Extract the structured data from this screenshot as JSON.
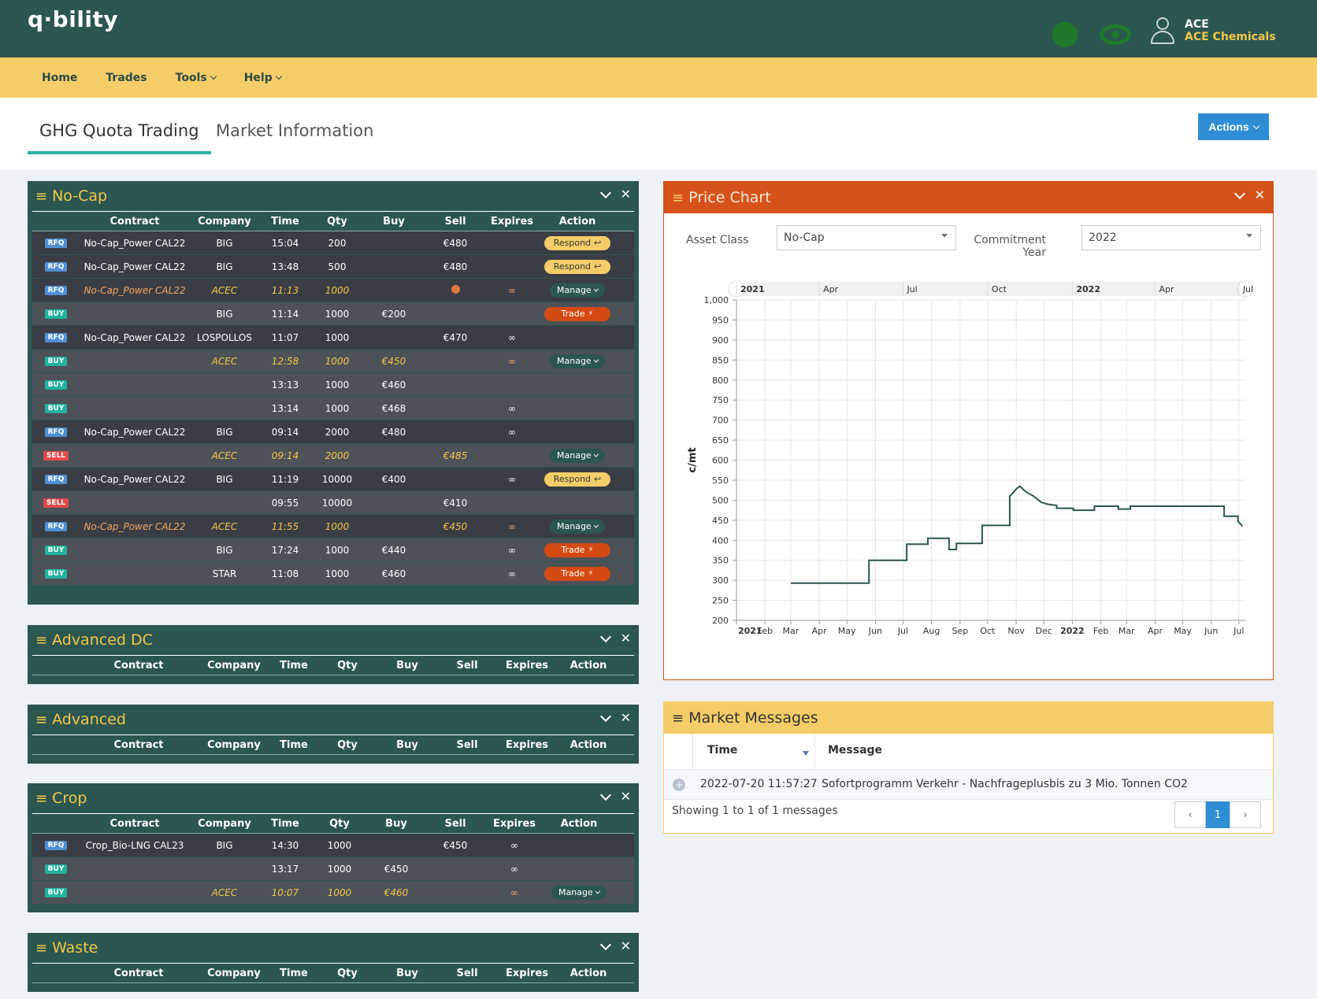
{
  "app": {
    "logo": "q·bility",
    "user_code": "ACE",
    "user_company": "ACE Chemicals"
  },
  "nav": {
    "home": "Home",
    "trades": "Trades",
    "tools": "Tools",
    "help": "Help"
  },
  "tabs": {
    "ghg": "GHG Quota Trading",
    "market": "Market Information"
  },
  "actions_label": "Actions",
  "columns": {
    "contract": "Contract",
    "company": "Company",
    "time": "Time",
    "qty": "Qty",
    "buy": "Buy",
    "sell": "Sell",
    "expires": "Expires",
    "action": "Action"
  },
  "panels": {
    "nocap": "No-Cap",
    "advdc": "Advanced DC",
    "adv": "Advanced",
    "crop": "Crop",
    "waste": "Waste"
  },
  "nocap_rows": [
    {
      "badge": "RFQ",
      "contract": "No-Cap_Power CAL22",
      "company": "BIG",
      "time": "15:04",
      "qty": "200",
      "buy": "",
      "sell": "€480",
      "expires": "",
      "action": "Respond",
      "mine": false,
      "shade": "dark"
    },
    {
      "badge": "RFQ",
      "contract": "No-Cap_Power CAL22",
      "company": "BIG",
      "time": "13:48",
      "qty": "500",
      "buy": "",
      "sell": "€480",
      "expires": "",
      "action": "Respond",
      "mine": false,
      "shade": "dark"
    },
    {
      "badge": "RFQ",
      "contract": "No-Cap_Power CAL22",
      "company": "ACEC",
      "time": "11:13",
      "qty": "1000",
      "buy": "",
      "sell": "",
      "expires": "∞",
      "action": "Manage",
      "mine": true,
      "shade": "dark",
      "check": true
    },
    {
      "badge": "BUY",
      "contract": "",
      "company": "BIG",
      "time": "11:14",
      "qty": "1000",
      "buy": "€200",
      "sell": "",
      "expires": "",
      "action": "Trade",
      "mine": false,
      "shade": "light"
    },
    {
      "badge": "RFQ",
      "contract": "No-Cap_Power CAL22",
      "company": "LOSPOLLOS",
      "time": "11:07",
      "qty": "1000",
      "buy": "",
      "sell": "€470",
      "expires": "∞",
      "action": "",
      "mine": false,
      "shade": "dark"
    },
    {
      "badge": "BUY",
      "contract": "",
      "company": "ACEC",
      "time": "12:58",
      "qty": "1000",
      "buy": "€450",
      "sell": "",
      "expires": "∞",
      "action": "Manage",
      "mine": true,
      "shade": "light"
    },
    {
      "badge": "BUY",
      "contract": "",
      "company": "",
      "time": "13:13",
      "qty": "1000",
      "buy": "€460",
      "sell": "",
      "expires": "",
      "action": "",
      "mine": false,
      "shade": "light"
    },
    {
      "badge": "BUY",
      "contract": "",
      "company": "",
      "time": "13:14",
      "qty": "1000",
      "buy": "€468",
      "sell": "",
      "expires": "∞",
      "action": "",
      "mine": false,
      "shade": "light"
    },
    {
      "badge": "RFQ",
      "contract": "No-Cap_Power CAL22",
      "company": "BIG",
      "time": "09:14",
      "qty": "2000",
      "buy": "€480",
      "sell": "",
      "expires": "∞",
      "action": "",
      "mine": false,
      "shade": "dark"
    },
    {
      "badge": "SELL",
      "contract": "",
      "company": "ACEC",
      "time": "09:14",
      "qty": "2000",
      "buy": "",
      "sell": "€485",
      "expires": "",
      "action": "Manage",
      "mine": true,
      "shade": "light"
    },
    {
      "badge": "RFQ",
      "contract": "No-Cap_Power CAL22",
      "company": "BIG",
      "time": "11:19",
      "qty": "10000",
      "buy": "€400",
      "sell": "",
      "expires": "∞",
      "action": "Respond",
      "mine": false,
      "shade": "dark"
    },
    {
      "badge": "SELL",
      "contract": "",
      "company": "",
      "time": "09:55",
      "qty": "10000",
      "buy": "",
      "sell": "€410",
      "expires": "",
      "action": "",
      "mine": false,
      "shade": "light"
    },
    {
      "badge": "RFQ",
      "contract": "No-Cap_Power CAL22",
      "company": "ACEC",
      "time": "11:55",
      "qty": "1000",
      "buy": "",
      "sell": "€450",
      "expires": "∞",
      "action": "Manage",
      "mine": true,
      "shade": "dark"
    },
    {
      "badge": "BUY",
      "contract": "",
      "company": "BIG",
      "time": "17:24",
      "qty": "1000",
      "buy": "€440",
      "sell": "",
      "expires": "∞",
      "action": "Trade",
      "mine": false,
      "shade": "light"
    },
    {
      "badge": "BUY",
      "contract": "",
      "company": "STAR",
      "time": "11:08",
      "qty": "1000",
      "buy": "€460",
      "sell": "",
      "expires": "∞",
      "action": "Trade",
      "mine": false,
      "shade": "light"
    }
  ],
  "crop_rows": [
    {
      "badge": "RFQ",
      "contract": "Crop_Bio-LNG CAL23",
      "company": "BIG",
      "time": "14:30",
      "qty": "1000",
      "buy": "",
      "sell": "€450",
      "expires": "∞",
      "action": "",
      "mine": false,
      "shade": "dark"
    },
    {
      "badge": "BUY",
      "contract": "",
      "company": "",
      "time": "13:17",
      "qty": "1000",
      "buy": "€450",
      "sell": "",
      "expires": "∞",
      "action": "",
      "mine": false,
      "shade": "light"
    },
    {
      "badge": "BUY",
      "contract": "",
      "company": "ACEC",
      "time": "10:07",
      "qty": "1000",
      "buy": "€460",
      "sell": "",
      "expires": "∞",
      "action": "Manage",
      "mine": true,
      "shade": "light"
    }
  ],
  "price_chart": {
    "title": "Price Chart",
    "asset_class_label": "Asset Class",
    "asset_class_value": "No-Cap",
    "commitment_label_1": "Commitment",
    "commitment_label_2": "Year",
    "commitment_value": "2022"
  },
  "chart_data": {
    "type": "line",
    "ylabel": "c/mt",
    "ylim": [
      200,
      1000
    ],
    "yticks": [
      "200",
      "250",
      "300",
      "350",
      "400",
      "450",
      "500",
      "550",
      "600",
      "650",
      "700",
      "750",
      "800",
      "850",
      "900",
      "950",
      "1,000"
    ],
    "xticks": [
      "2021",
      "Feb",
      "Mar",
      "Apr",
      "May",
      "Jun",
      "Jul",
      "Aug",
      "Sep",
      "Oct",
      "Nov",
      "Dec",
      "2022",
      "Feb",
      "Mar",
      "Apr",
      "May",
      "Jun",
      "Jul"
    ],
    "navigator_ticks": [
      "2021",
      "Apr",
      "Jul",
      "Oct",
      "2022",
      "Apr",
      "Jul"
    ],
    "series": [
      {
        "x": [
          "2021-03-01",
          "2021-05-25",
          "2021-05-25",
          "2021-07-05",
          "2021-07-05",
          "2021-07-28",
          "2021-07-28",
          "2021-08-20",
          "2021-08-20",
          "2021-08-28",
          "2021-08-28",
          "2021-09-25",
          "2021-09-25",
          "2021-10-25",
          "2021-10-25",
          "2021-11-02",
          "2021-11-05",
          "2021-11-12",
          "2021-11-20",
          "2021-11-28",
          "2021-12-05",
          "2021-12-15",
          "2021-12-15",
          "2022-01-02",
          "2022-01-02",
          "2022-01-25",
          "2022-01-25",
          "2022-02-20",
          "2022-02-20",
          "2022-03-05",
          "2022-03-05",
          "2022-06-15",
          "2022-06-15",
          "2022-06-30",
          "2022-06-30",
          "2022-07-05"
        ],
        "y": [
          293,
          293,
          350,
          350,
          390,
          390,
          405,
          405,
          377,
          377,
          392,
          392,
          437,
          437,
          510,
          530,
          535,
          520,
          510,
          495,
          490,
          487,
          480,
          480,
          475,
          475,
          485,
          485,
          478,
          478,
          485,
          485,
          460,
          460,
          447,
          435
        ]
      }
    ]
  },
  "messages": {
    "title": "Market Messages",
    "col_time": "Time",
    "col_message": "Message",
    "row_time": "2022-07-20 11:57:27",
    "row_text": "Sofortprogramm Verkehr - Nachfrageplusbis zu 3 Mio. Tonnen CO2",
    "footer": "Showing 1 to 1 of 1 messages",
    "page": "1",
    "prev": "‹",
    "next": "›"
  },
  "colors": {
    "header": "#2c5650",
    "nav": "#f5cd68",
    "price_accent": "#d7521a",
    "line": "#2c5650"
  }
}
